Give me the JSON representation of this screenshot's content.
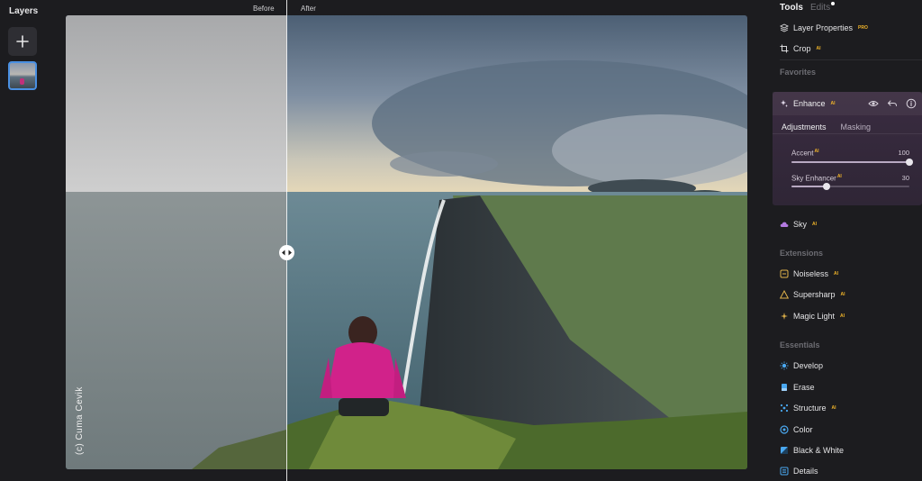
{
  "layers": {
    "title": "Layers"
  },
  "compare": {
    "before_label": "Before",
    "after_label": "After",
    "watermark": "(c) Cuma Cevik"
  },
  "panel": {
    "tabs": [
      {
        "label": "Tools"
      },
      {
        "label": "Edits"
      }
    ],
    "tools": [
      {
        "label": "Layer Properties",
        "badge": "PRO",
        "icon": "layers-icon"
      },
      {
        "label": "Crop",
        "badge": "AI",
        "icon": "crop-icon"
      }
    ],
    "favorites_title": "Favorites",
    "enhance": {
      "label": "Enhance",
      "badge": "AI",
      "subtabs": [
        "Adjustments",
        "Masking"
      ],
      "sliders": [
        {
          "label": "Accent",
          "badge": "AI",
          "value": 100,
          "max": 100
        },
        {
          "label": "Sky Enhancer",
          "badge": "AI",
          "value": 30,
          "max": 100
        }
      ]
    },
    "sky": {
      "label": "Sky",
      "badge": "AI"
    },
    "extensions_title": "Extensions",
    "extensions": [
      {
        "label": "Noiseless",
        "badge": "AI"
      },
      {
        "label": "Supersharp",
        "badge": "AI"
      },
      {
        "label": "Magic Light",
        "badge": "AI"
      }
    ],
    "essentials_title": "Essentials",
    "essentials": [
      {
        "label": "Develop"
      },
      {
        "label": "Erase"
      },
      {
        "label": "Structure",
        "badge": "AI"
      },
      {
        "label": "Color"
      },
      {
        "label": "Black & White"
      },
      {
        "label": "Details"
      }
    ]
  },
  "colors": {
    "accent": "#4a90e2",
    "ai_badge": "#f0b429",
    "panel_bg": "#1c1c1f",
    "enhance_card": "#3a2c40"
  }
}
